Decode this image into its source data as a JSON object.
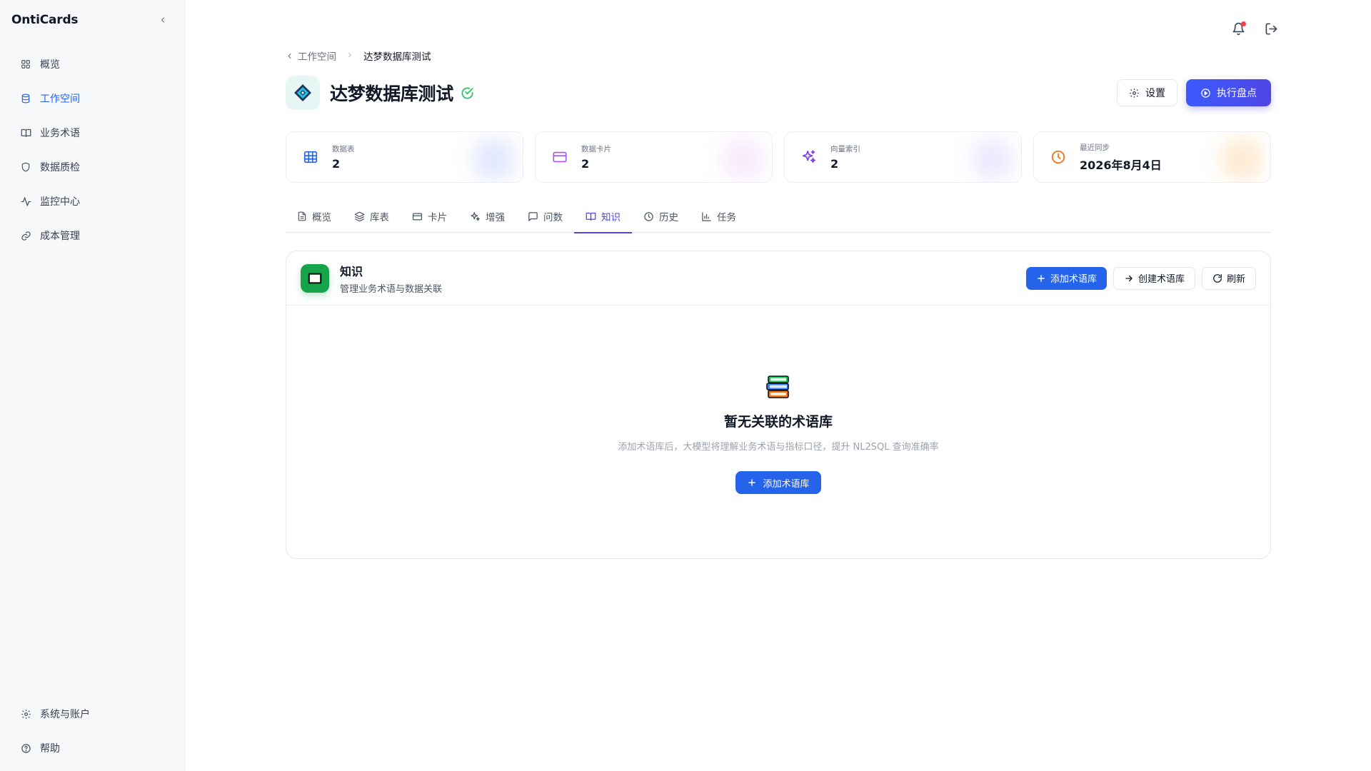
{
  "app": {
    "brand": "OntiCards"
  },
  "sidebar": {
    "items": [
      {
        "label": "概览",
        "icon": "grid-icon"
      },
      {
        "label": "工作空间",
        "icon": "database-icon",
        "active": true
      },
      {
        "label": "业务术语",
        "icon": "book-icon"
      },
      {
        "label": "数据质检",
        "icon": "shield-icon"
      },
      {
        "label": "监控中心",
        "icon": "activity-icon"
      },
      {
        "label": "成本管理",
        "icon": "link-icon"
      }
    ],
    "bottom": [
      {
        "label": "系统与账户",
        "icon": "gear-icon"
      },
      {
        "label": "帮助",
        "icon": "help-circle-icon"
      }
    ]
  },
  "breadcrumb": {
    "parent": "工作空间",
    "current": "达梦数据库测试"
  },
  "header": {
    "title": "达梦数据库测试",
    "settings_label": "设置",
    "run_label": "执行盘点"
  },
  "stats": [
    {
      "label": "数据表",
      "value": "2",
      "color": "#2563eb"
    },
    {
      "label": "数据卡片",
      "value": "2",
      "color": "#a855f7"
    },
    {
      "label": "向量索引",
      "value": "2",
      "color": "#7c3aed"
    },
    {
      "label": "最近同步",
      "value": "2026年8月4日",
      "color": "#f97316"
    }
  ],
  "tabs": [
    {
      "label": "概览",
      "icon": "file-icon"
    },
    {
      "label": "库表",
      "icon": "layers-icon"
    },
    {
      "label": "卡片",
      "icon": "card-icon"
    },
    {
      "label": "增强",
      "icon": "sparkles-icon"
    },
    {
      "label": "问数",
      "icon": "message-icon"
    },
    {
      "label": "知识",
      "icon": "book-open-icon",
      "active": true
    },
    {
      "label": "历史",
      "icon": "clock-icon"
    },
    {
      "label": "任务",
      "icon": "bar-chart-icon"
    }
  ],
  "panel": {
    "title": "知识",
    "subtitle": "管理业务术语与数据关联",
    "add_label": "添加术语库",
    "create_label": "创建术语库",
    "refresh_label": "刷新"
  },
  "empty": {
    "title": "暂无关联的术语库",
    "desc": "添加术语库后，大模型将理解业务术语与指标口径，提升 NL2SQL 查询准确率",
    "button_label": "添加术语库"
  },
  "colors": {
    "accent": "#4f46e5",
    "primary": "#2563eb",
    "success": "#16a34a",
    "danger": "#ef4444"
  }
}
